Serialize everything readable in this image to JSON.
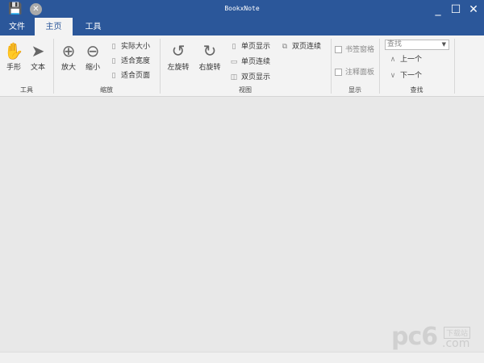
{
  "app": {
    "title": "BookxNote",
    "accent": "#2b579a"
  },
  "quick_access": {
    "save_icon": "save-icon",
    "close_icon": "close-circle-icon"
  },
  "window_controls": {
    "minimize": "_",
    "maximize": "☐",
    "close": "✕"
  },
  "tabs": [
    {
      "label": "文件"
    },
    {
      "label": "主页",
      "active": true
    },
    {
      "label": "工具"
    }
  ],
  "ribbon": {
    "tools": {
      "label": "工具",
      "hand": "手形",
      "text": "文本"
    },
    "zoom": {
      "label": "缩放",
      "zoom_in": "放大",
      "zoom_out": "缩小",
      "actual": "实际大小",
      "fit_width": "适合宽度",
      "fit_page": "适合页面"
    },
    "view": {
      "label": "视图",
      "rotate_left": "左旋转",
      "rotate_right": "右旋转",
      "single": "单页显示",
      "single_cont": "单页连续",
      "double": "双页显示",
      "double_cont": "双页连续"
    },
    "show": {
      "label": "显示",
      "bookmark": "书签窗格",
      "annotation": "注释面板"
    },
    "find": {
      "label": "查找",
      "placeholder": "查找",
      "prev": "上一个",
      "next": "下一个"
    }
  },
  "watermark": {
    "logo": "pc6",
    "sub": "下载站",
    "domain": ".com"
  }
}
